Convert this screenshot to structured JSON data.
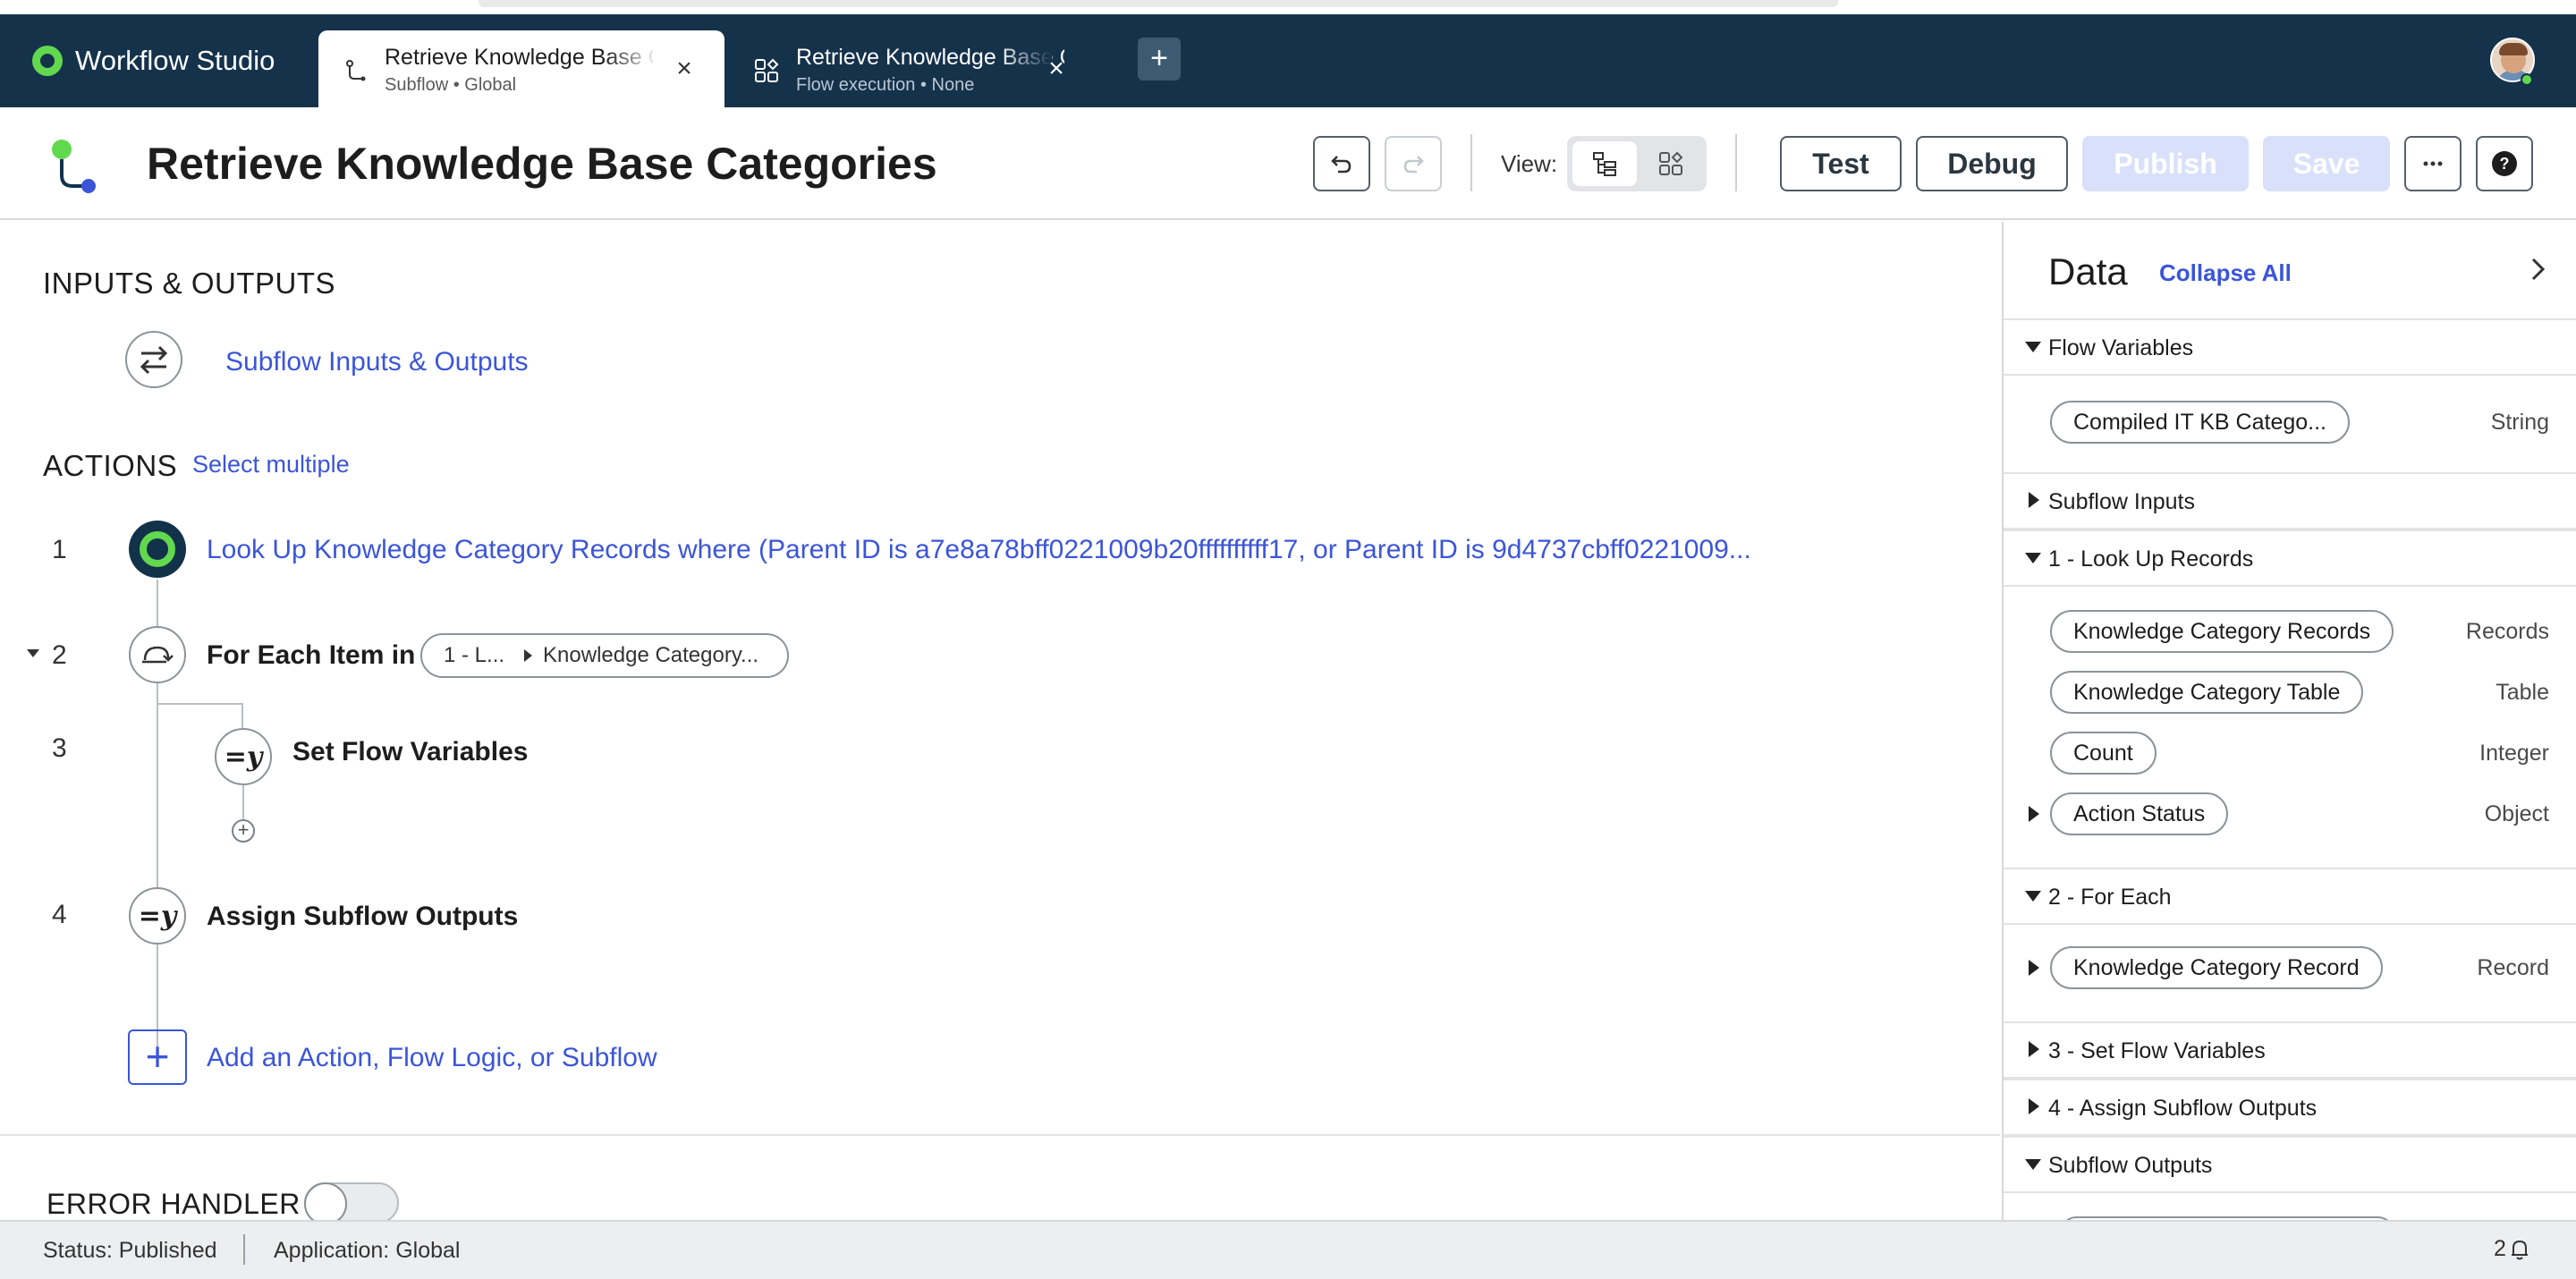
{
  "app": {
    "name": "Workflow Studio",
    "brand_color": "#62d84e",
    "header_color": "#15324b"
  },
  "tabs": [
    {
      "title": "Retrieve Knowledge Base Categories",
      "subtitle": "Subflow • Global",
      "icon": "subflow-icon"
    },
    {
      "title": "Retrieve Knowledge Base Categories",
      "subtitle": "Flow execution • None",
      "icon": "flow-execution-icon"
    }
  ],
  "toolbar": {
    "title": "Retrieve Knowledge Base Categories",
    "view_label": "View:",
    "test_label": "Test",
    "debug_label": "Debug",
    "publish_label": "Publish",
    "save_label": "Save"
  },
  "canvas": {
    "io_heading": "INPUTS & OUTPUTS",
    "io_link": "Subflow Inputs & Outputs",
    "actions_heading": "ACTIONS",
    "select_multiple": "Select multiple",
    "steps": [
      {
        "num": "1",
        "text": "Look Up Knowledge Category Records where (Parent ID is a7e8a78bff0221009b20ffffffffff17, or Parent ID is 9d4737cbff0221009..."
      },
      {
        "num": "2",
        "text": "For Each Item in",
        "pill_a": "1 - L...",
        "pill_b": "Knowledge Category..."
      },
      {
        "num": "3",
        "text": "Set Flow Variables"
      },
      {
        "num": "4",
        "text": "Assign Subflow Outputs"
      }
    ],
    "add_action": "Add an Action, Flow Logic, or Subflow",
    "error_handler": "ERROR HANDLER"
  },
  "panel": {
    "title": "Data",
    "collapse_all": "Collapse All",
    "sections": {
      "flow_variables": "Flow Variables",
      "subflow_inputs": "Subflow Inputs",
      "lookup": "1 - Look Up Records",
      "for_each": "2 - For Each",
      "set_flow_vars": "3 - Set Flow Variables",
      "assign_outputs": "4 - Assign Subflow Outputs",
      "subflow_outputs": "Subflow Outputs"
    },
    "flow_variables": [
      {
        "name": "Compiled IT KB Catego...",
        "type": "String"
      }
    ],
    "lookup_vars": [
      {
        "name": "Knowledge Category Records",
        "type": "Records"
      },
      {
        "name": "Knowledge Category Table",
        "type": "Table"
      },
      {
        "name": "Count",
        "type": "Integer"
      },
      {
        "name": "Action Status",
        "type": "Object"
      }
    ],
    "for_each_vars": [
      {
        "name": "Knowledge Category Record",
        "type": "Record"
      }
    ]
  },
  "status": {
    "status": "Status: Published",
    "application": "Application: Global",
    "notifications": "2"
  }
}
